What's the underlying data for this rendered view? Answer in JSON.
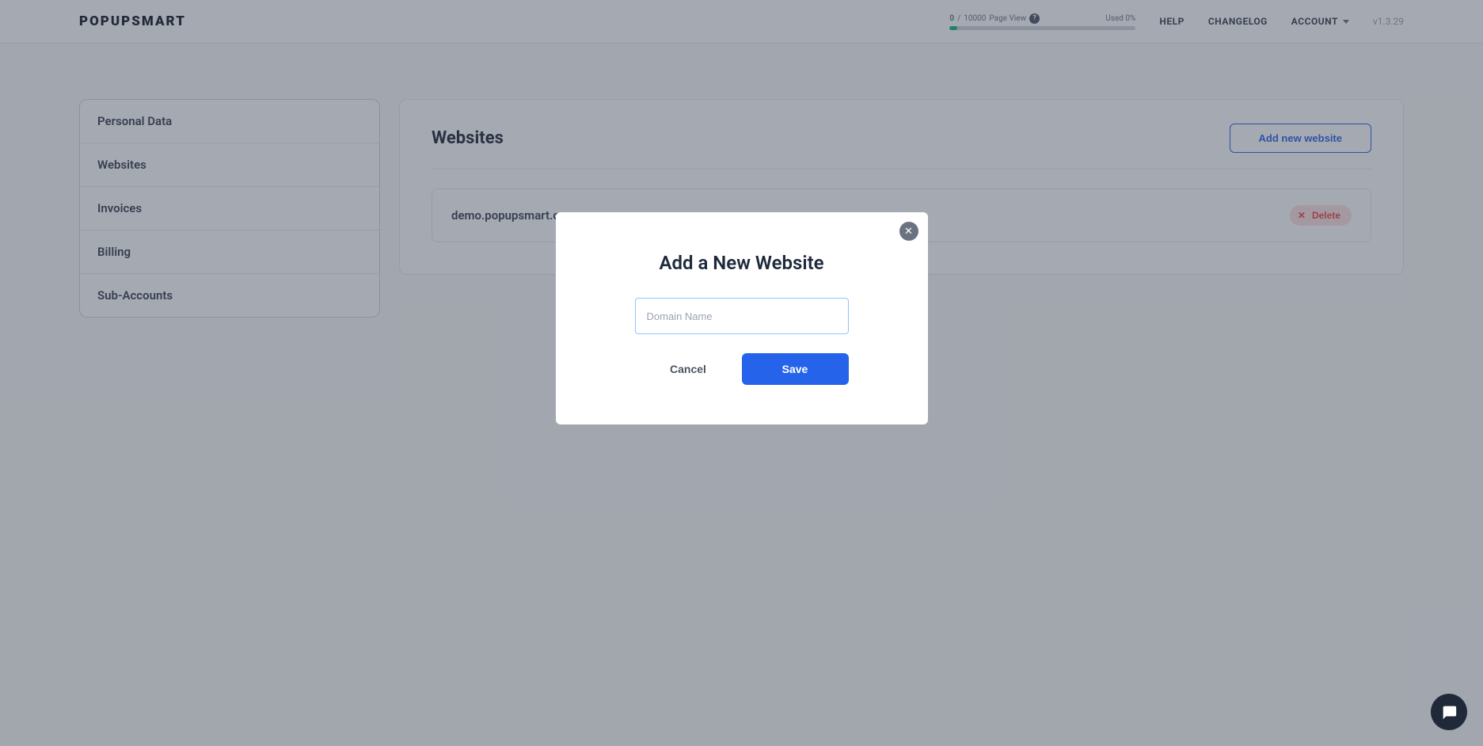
{
  "header": {
    "logo": "POPUPSMART",
    "usage": {
      "current": "0",
      "sep": "/",
      "max": "10000",
      "label": "Page View",
      "used_label": "Used 0%"
    },
    "nav": {
      "help": "HELP",
      "changelog": "CHANGELOG",
      "account": "ACCOUNT"
    },
    "version": "v1.3.29"
  },
  "sidebar": {
    "items": [
      {
        "label": "Personal Data"
      },
      {
        "label": "Websites"
      },
      {
        "label": "Invoices"
      },
      {
        "label": "Billing"
      },
      {
        "label": "Sub-Accounts"
      }
    ]
  },
  "main": {
    "title": "Websites",
    "add_button": "Add new website",
    "sites": [
      {
        "domain": "demo.popupsmart.com",
        "delete": "Delete"
      }
    ]
  },
  "modal": {
    "title": "Add a New Website",
    "input_placeholder": "Domain Name",
    "cancel": "Cancel",
    "save": "Save"
  }
}
